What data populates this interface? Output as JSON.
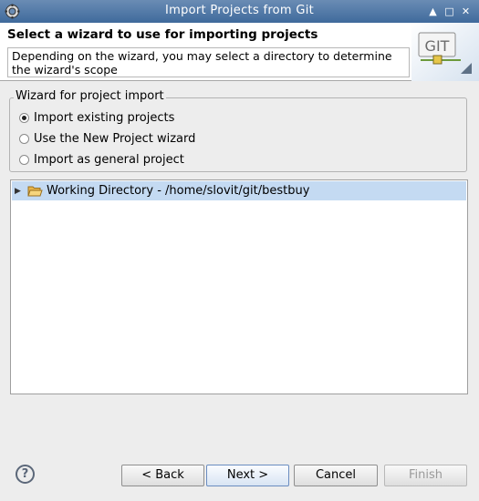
{
  "window": {
    "title": "Import Projects from Git",
    "controls": [
      "▲",
      "□",
      "✕"
    ]
  },
  "header": {
    "title": "Select a wizard to use for importing projects",
    "message": "Depending on the wizard, you may select a directory to determine the wizard's scope",
    "logo_text": "GIT"
  },
  "wizard_group": {
    "label": "Wizard for project import",
    "options": [
      {
        "label": "Import existing projects",
        "selected": true
      },
      {
        "label": "Use the New Project wizard",
        "selected": false
      },
      {
        "label": "Import as general project",
        "selected": false
      }
    ]
  },
  "tree": {
    "items": [
      {
        "label": "Working Directory - /home/slovit/git/bestbuy",
        "expanded": false,
        "selected": true
      }
    ]
  },
  "buttons": {
    "help": "?",
    "back": "< Back",
    "next": "Next >",
    "cancel": "Cancel",
    "finish": "Finish"
  }
}
